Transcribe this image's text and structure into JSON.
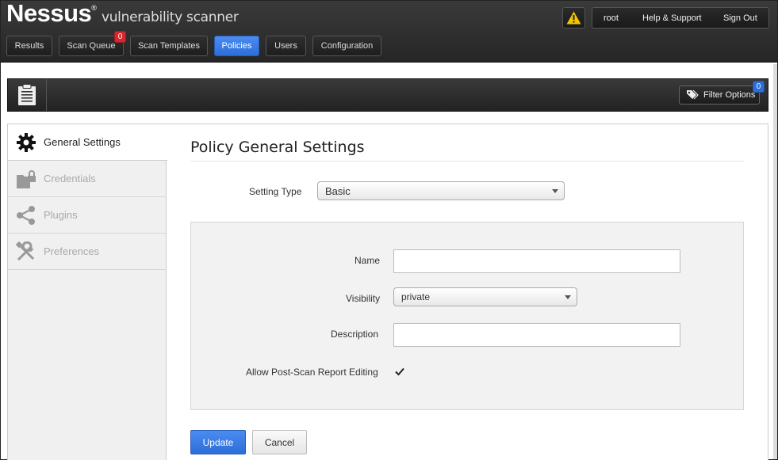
{
  "brand": {
    "name": "Nessus",
    "reg": "®",
    "subtitle": "vulnerability scanner"
  },
  "user_bar": {
    "username": "root",
    "help": "Help & Support",
    "signout": "Sign Out"
  },
  "nav": {
    "tabs": [
      {
        "label": "Results"
      },
      {
        "label": "Scan Queue",
        "badge": "0"
      },
      {
        "label": "Scan Templates"
      },
      {
        "label": "Policies",
        "active": true
      },
      {
        "label": "Users"
      },
      {
        "label": "Configuration"
      }
    ]
  },
  "toolbar": {
    "filter_label": "Filter Options",
    "filter_badge": "0"
  },
  "sidebar": {
    "items": [
      {
        "label": "General Settings",
        "icon": "gear-icon",
        "active": true
      },
      {
        "label": "Credentials",
        "icon": "locked-folder-icon"
      },
      {
        "label": "Plugins",
        "icon": "share-nodes-icon"
      },
      {
        "label": "Preferences",
        "icon": "wrench-screwdriver-icon"
      }
    ]
  },
  "main": {
    "title": "Policy General Settings",
    "setting_type": {
      "label": "Setting Type",
      "value": "Basic"
    },
    "name": {
      "label": "Name",
      "value": ""
    },
    "visibility": {
      "label": "Visibility",
      "value": "private"
    },
    "description": {
      "label": "Description",
      "value": ""
    },
    "allow_edit": {
      "label": "Allow Post-Scan Report Editing",
      "checked": true
    },
    "update_label": "Update",
    "cancel_label": "Cancel"
  },
  "colors": {
    "primary": "#2d6fd9",
    "badge_red": "#d8262e",
    "warning_yellow": "#f5c400",
    "header_dark": "#2a2a2a"
  }
}
